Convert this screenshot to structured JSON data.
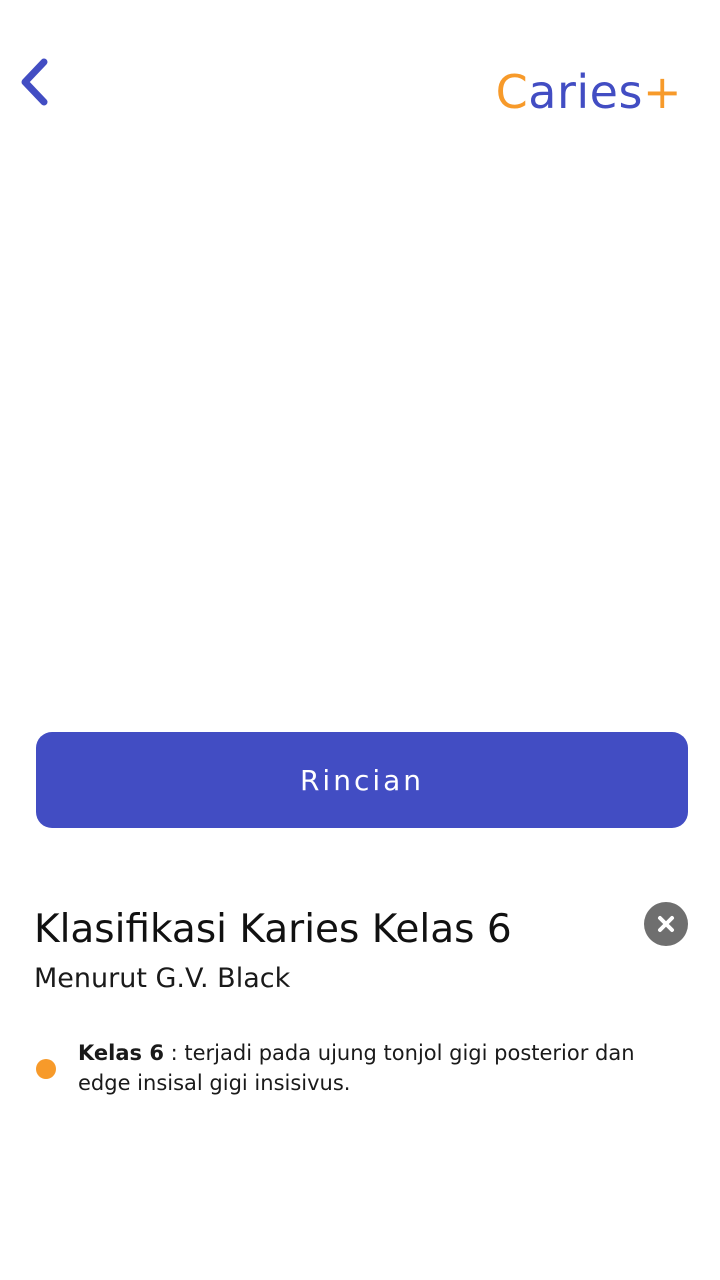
{
  "header": {
    "back_icon": "chevron-left-icon",
    "logo_first_letter": "C",
    "logo_rest": "aries",
    "logo_plus": "+",
    "colors": {
      "primary": "#424DC3",
      "accent": "#F79A2A"
    }
  },
  "actions": {
    "rincian_label": "Rincian"
  },
  "info": {
    "title": "Klasifikasi Karies Kelas 6",
    "subtitle": "Menurut G.V. Black",
    "close_icon": "close-icon",
    "bullets": [
      {
        "term": "Kelas 6",
        "description": " : terjadi pada ujung tonjol gigi posterior dan edge insisal gigi insisivus."
      }
    ]
  }
}
